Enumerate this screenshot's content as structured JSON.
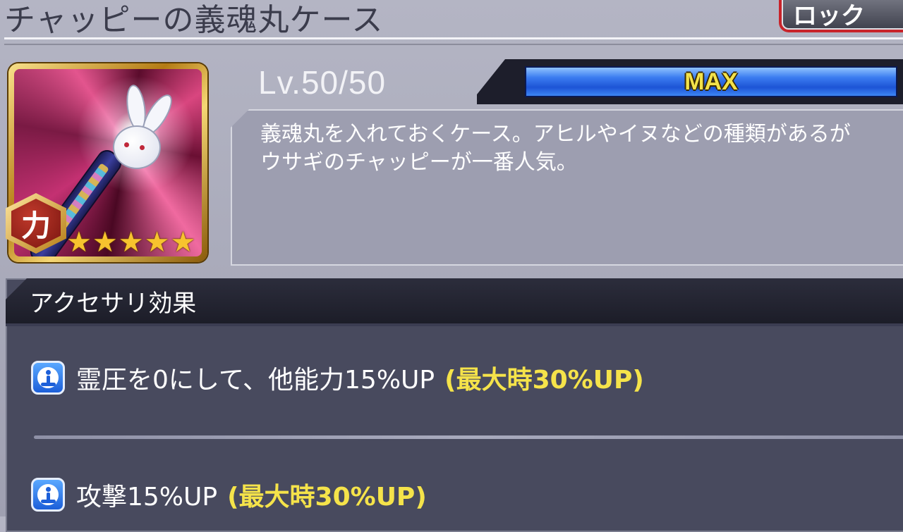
{
  "header": {
    "title": "チャッピーの義魂丸ケース",
    "lock_label": "ロック"
  },
  "item": {
    "icon_name": "chappy-soul-candy-case-icon",
    "attribute_label": "力",
    "stars": 5,
    "level_text": "Lv.50/50",
    "exp_label": "MAX",
    "exp_progress": 1.0,
    "description": "義魂丸を入れておくケース。アヒルやイヌなどの種類があるがウサギのチャッピーが一番人気。"
  },
  "effects": {
    "title": "アクセサリ効果",
    "items": [
      {
        "text": "霊圧を0にして、他能力15%UP",
        "max_text": "(最大時30%UP)"
      },
      {
        "text": "攻撃15%UP",
        "max_text": "(最大時30%UP)"
      }
    ]
  },
  "colors": {
    "accent_yellow": "#f5e34a",
    "exp_bar_blue": "#1d54d6",
    "lock_red": "#c8232a"
  }
}
